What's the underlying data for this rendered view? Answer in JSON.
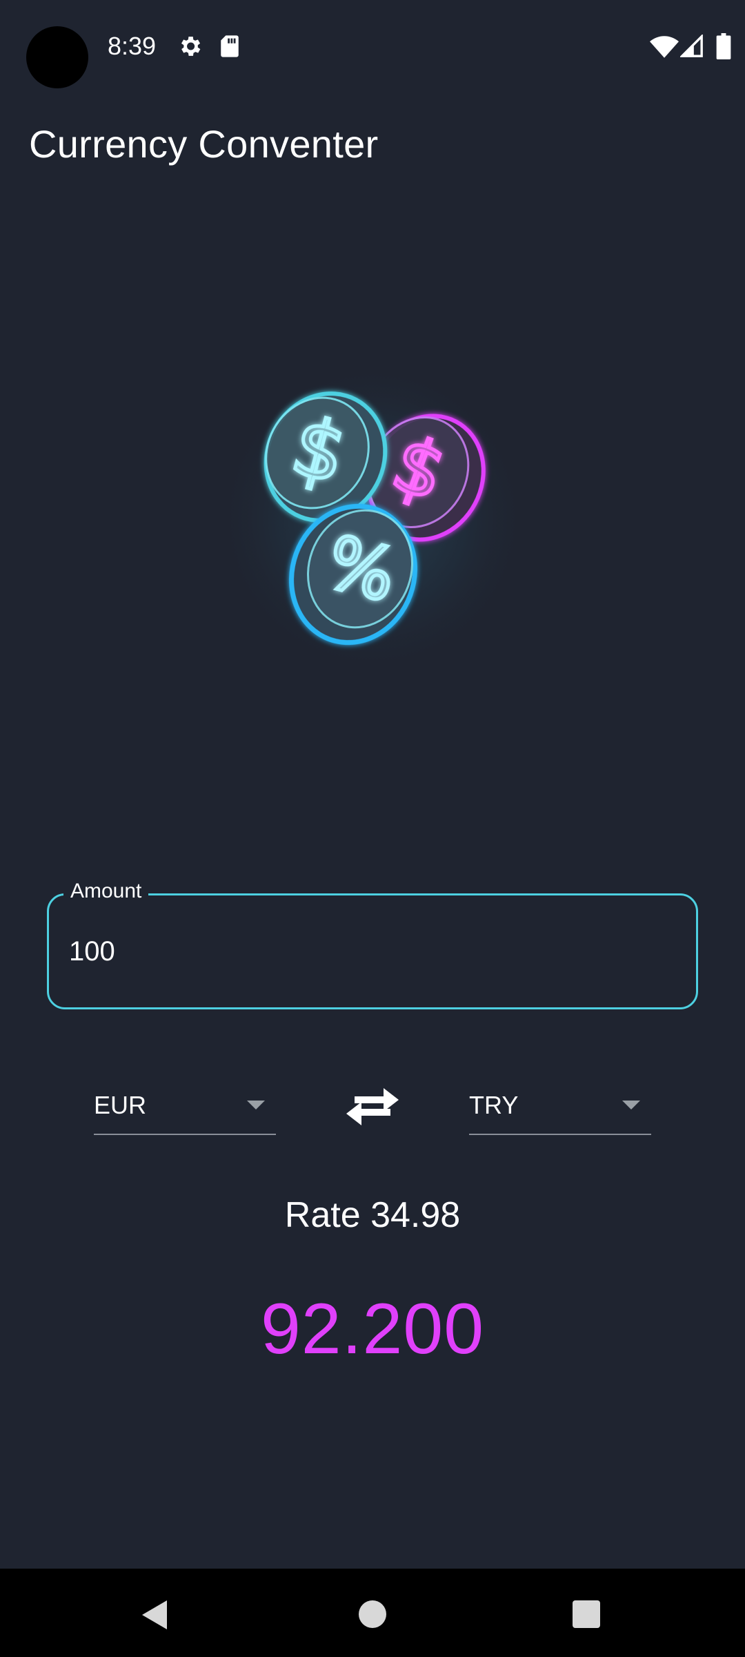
{
  "status_bar": {
    "time": "8:39",
    "icons": [
      "camera-cutout",
      "gear-icon",
      "sd-card-icon",
      "wifi-icon",
      "signal-icon",
      "battery-icon"
    ]
  },
  "app": {
    "title": "Currency Conventer"
  },
  "illustration": {
    "description_icon": "neon-coins-icon",
    "glyphs": [
      "$",
      "$",
      "%"
    ],
    "colors": {
      "cyan": "#4dd0e1",
      "magenta": "#e040fb"
    }
  },
  "amount": {
    "label": "Amount",
    "value": "100"
  },
  "conversion": {
    "from_currency": "EUR",
    "to_currency": "TRY",
    "rate_text": "Rate 34.98",
    "result": "92.200"
  },
  "theme": {
    "background": "#1f2430",
    "accent_border": "#4dd0e1",
    "result_color": "#e040fb",
    "nav_bar": "#000000"
  },
  "nav_bar": {
    "icons": [
      "back-icon",
      "home-icon",
      "recents-icon"
    ]
  }
}
